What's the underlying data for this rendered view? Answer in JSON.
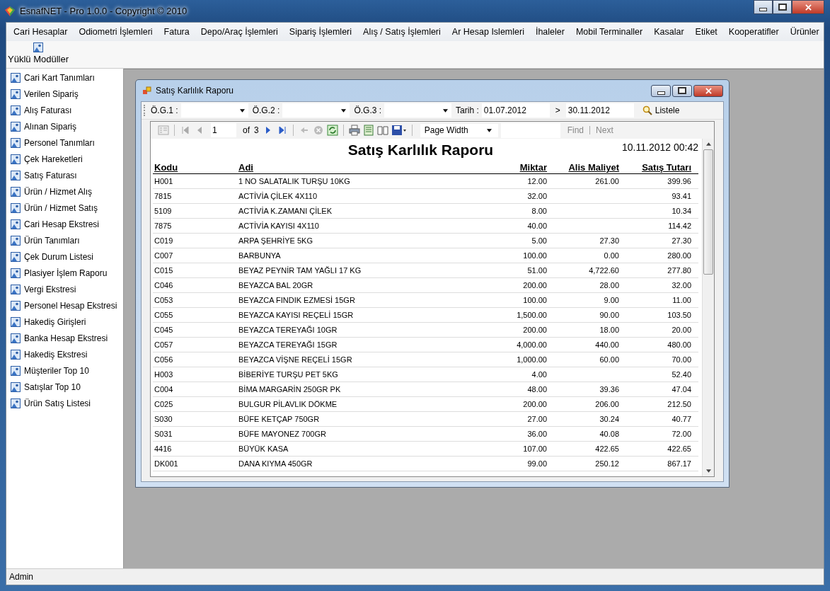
{
  "window": {
    "title": "EsnafNET - Pro 1.0.0 - Copyright ©  2010"
  },
  "menu": [
    "Cari Hesaplar",
    "Odiometri İşlemleri",
    "Fatura",
    "Depo/Araç İşlemleri",
    "Sipariş İşlemleri",
    "Alış / Satış İşlemleri",
    "Ar Hesap Islemleri",
    "İhaleler",
    "Mobil Terminaller",
    "Kasalar",
    "Etiket",
    "Kooperatifler",
    "Ürünler"
  ],
  "toolbar": {
    "label": "Yüklü Modüller"
  },
  "sidebar": {
    "items": [
      "Cari Kart Tanımları",
      "Verilen Sipariş",
      "Alış Faturası",
      "Alınan Sipariş",
      "Personel Tanımları",
      "Çek Hareketleri",
      "Satış Faturası",
      "Ürün / Hizmet Alış",
      "Ürün / Hizmet Satış",
      "Cari Hesap Ekstresi",
      "Ürün Tanımları",
      "Çek Durum Listesi",
      "Plasiyer İşlem Raporu",
      "Vergi Ekstresi",
      "Personel Hesap Ekstresi",
      "Hakediş Girişleri",
      "Banka Hesap Ekstresi",
      "Hakediş Ekstresi",
      "Müşteriler Top 10",
      "Satışlar Top 10",
      "Ürün Satış Listesi"
    ]
  },
  "child_window": {
    "title": "Satış Karlılık Raporu",
    "filters": [
      {
        "label": "Ö.G.1 :"
      },
      {
        "label": "Ö.G.2 :"
      },
      {
        "label": "Ö.G.3 :"
      }
    ],
    "date_label": "Tarih :",
    "date_from": "01.07.2012",
    "date_sep": ">",
    "date_to": "30.11.2012",
    "list_button": "Listele",
    "viewer": {
      "page": "1",
      "of": "of",
      "pages": "3",
      "zoom": "Page Width",
      "find": "Find",
      "next": "Next"
    },
    "report": {
      "title": "Satış Karlılık Raporu",
      "timestamp": "10.11.2012 00:42",
      "columns": [
        "Kodu",
        "Adi",
        "Miktar",
        "Alis Maliyet",
        "Satış Tutarı"
      ],
      "rows": [
        [
          "H001",
          "1 NO SALATALIK TURŞU 10KG",
          "12.00",
          "261.00",
          "399.96"
        ],
        [
          "7815",
          "ACTİVİA ÇİLEK 4X110",
          "32.00",
          "",
          "93.41"
        ],
        [
          "5109",
          "ACTİVİA K.ZAMANI ÇİLEK",
          "8.00",
          "",
          "10.34"
        ],
        [
          "7875",
          "ACTİVİA KAYISI 4X110",
          "40.00",
          "",
          "114.42"
        ],
        [
          "C019",
          "ARPA ŞEHRİYE 5KG",
          "5.00",
          "27.30",
          "27.30"
        ],
        [
          "C007",
          "BARBUNYA",
          "100.00",
          "0.00",
          "280.00"
        ],
        [
          "C015",
          "BEYAZ PEYNİR TAM YAĞLI 17 KG",
          "51.00",
          "4,722.60",
          "277.80"
        ],
        [
          "C046",
          "BEYAZCA BAL 20GR",
          "200.00",
          "28.00",
          "32.00"
        ],
        [
          "C053",
          "BEYAZCA FINDIK EZMESİ 15GR",
          "100.00",
          "9.00",
          "11.00"
        ],
        [
          "C055",
          "BEYAZCA KAYISI REÇELİ 15GR",
          "1,500.00",
          "90.00",
          "103.50"
        ],
        [
          "C045",
          "BEYAZCA TEREYAĞI 10GR",
          "200.00",
          "18.00",
          "20.00"
        ],
        [
          "C057",
          "BEYAZCA TEREYAĞI 15GR",
          "4,000.00",
          "440.00",
          "480.00"
        ],
        [
          "C056",
          "BEYAZCA VİŞNE REÇELİ 15GR",
          "1,000.00",
          "60.00",
          "70.00"
        ],
        [
          "H003",
          "BİBERİYE TURŞU PET 5KG",
          "4.00",
          "",
          "52.40"
        ],
        [
          "C004",
          "BİMA MARGARİN 250GR PK",
          "48.00",
          "39.36",
          "47.04"
        ],
        [
          "C025",
          "BULGUR PİLAVLIK DÖKME",
          "200.00",
          "206.00",
          "212.50"
        ],
        [
          "S030",
          "BÜFE KETÇAP 750GR",
          "27.00",
          "30.24",
          "40.77"
        ],
        [
          "S031",
          "BÜFE MAYONEZ 700GR",
          "36.00",
          "40.08",
          "72.00"
        ],
        [
          "4416",
          "BÜYÜK KASA",
          "107.00",
          "422.65",
          "422.65"
        ],
        [
          "DK001",
          "DANA KIYMA 450GR",
          "99.00",
          "250.12",
          "867.17"
        ]
      ]
    }
  },
  "status_bar": {
    "user": "Admin"
  }
}
